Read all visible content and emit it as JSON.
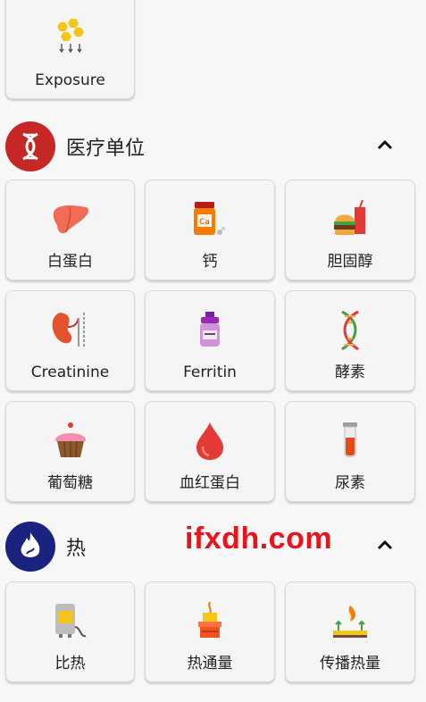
{
  "top_card": {
    "label": "Exposure",
    "icon": "exposure-icon"
  },
  "sections": [
    {
      "title": "医疗单位",
      "badge_icon": "dna-icon",
      "badge_color": "#c62828",
      "items": [
        {
          "label": "白蛋白",
          "icon": "liver-icon"
        },
        {
          "label": "钙",
          "icon": "calcium-jar-icon"
        },
        {
          "label": "胆固醇",
          "icon": "burger-drink-icon"
        },
        {
          "label": "Creatinine",
          "icon": "kidney-icon"
        },
        {
          "label": "Ferritin",
          "icon": "bottle-icon"
        },
        {
          "label": "酵素",
          "icon": "dna-strand-icon"
        },
        {
          "label": "葡萄糖",
          "icon": "cupcake-icon"
        },
        {
          "label": "血红蛋白",
          "icon": "blood-drop-icon"
        },
        {
          "label": "尿素",
          "icon": "test-tube-icon"
        }
      ]
    },
    {
      "title": "热",
      "badge_icon": "flame-icon",
      "badge_color": "#1a237e",
      "items": [
        {
          "label": "比热",
          "icon": "heater-icon"
        },
        {
          "label": "热通量",
          "icon": "burner-icon"
        },
        {
          "label": "传播热量",
          "icon": "heat-plate-icon"
        }
      ]
    }
  ],
  "watermark": "ifxdh.com"
}
